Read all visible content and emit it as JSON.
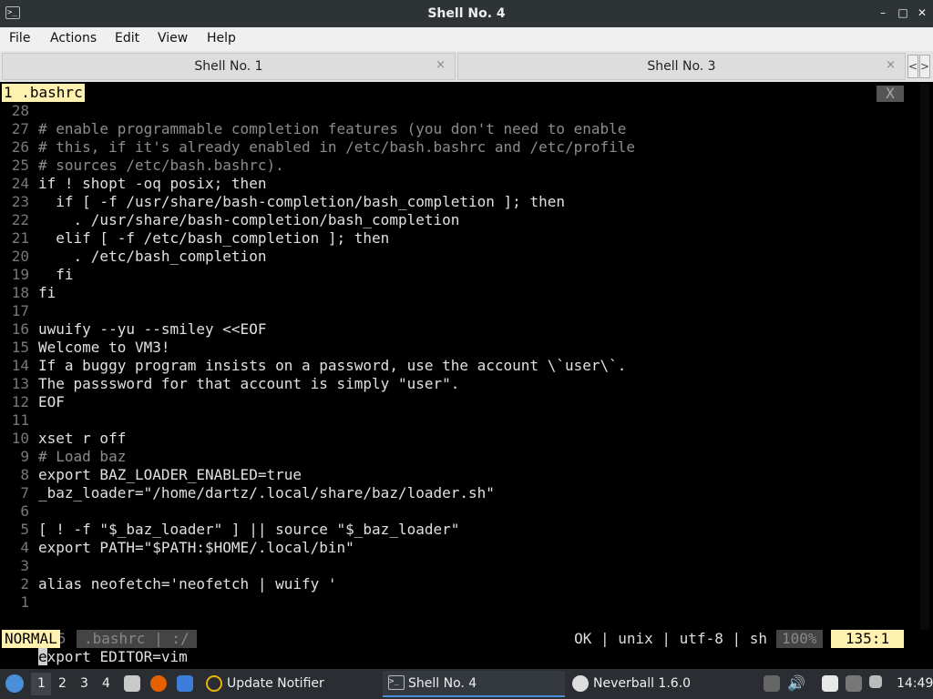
{
  "window": {
    "title": "Shell No. 4",
    "app_icon": "terminal-icon",
    "controls": [
      "minimize-icon",
      "maximize-icon",
      "close-icon"
    ]
  },
  "menu": {
    "file": "File",
    "actions": "Actions",
    "edit": "Edit",
    "view": "View",
    "help": "Help"
  },
  "tabs": [
    {
      "label": "Shell No. 1",
      "close": "×"
    },
    {
      "label": "Shell No. 3",
      "close": "×"
    }
  ],
  "tab_nav": {
    "prev": "<",
    "next": ">"
  },
  "vim": {
    "buffer": "1 .bashrc",
    "buffer_close": "X",
    "lines": [
      {
        "num": "28",
        "text": ""
      },
      {
        "num": "27",
        "text": "# enable programmable completion features (you don't need to enable"
      },
      {
        "num": "26",
        "text": "# this, if it's already enabled in /etc/bash.bashrc and /etc/profile"
      },
      {
        "num": "25",
        "text": "# sources /etc/bash.bashrc)."
      },
      {
        "num": "24",
        "text": "if ! shopt -oq posix; then"
      },
      {
        "num": "23",
        "text": "  if [ -f /usr/share/bash-completion/bash_completion ]; then"
      },
      {
        "num": "22",
        "text": "    . /usr/share/bash-completion/bash_completion"
      },
      {
        "num": "21",
        "text": "  elif [ -f /etc/bash_completion ]; then"
      },
      {
        "num": "20",
        "text": "    . /etc/bash_completion"
      },
      {
        "num": "19",
        "text": "  fi"
      },
      {
        "num": "18",
        "text": "fi"
      },
      {
        "num": "17",
        "text": ""
      },
      {
        "num": "16",
        "text": "uwuify --yu --smiley <<EOF"
      },
      {
        "num": "15",
        "text": "Welcome to VM3!"
      },
      {
        "num": "14",
        "text": "If a buggy program insists on a password, use the account \\`user\\`."
      },
      {
        "num": "13",
        "text": "The passsword for that account is simply \"user\"."
      },
      {
        "num": "12",
        "text": "EOF"
      },
      {
        "num": "11",
        "text": ""
      },
      {
        "num": "10",
        "text": "xset r off"
      },
      {
        "num": "9",
        "text": "# Load baz"
      },
      {
        "num": "8",
        "text": "export BAZ_LOADER_ENABLED=true"
      },
      {
        "num": "7",
        "text": "_baz_loader=\"/home/dartz/.local/share/baz/loader.sh\""
      },
      {
        "num": "6",
        "text": ""
      },
      {
        "num": "5",
        "text": "[ ! -f \"$_baz_loader\" ] || source \"$_baz_loader\""
      },
      {
        "num": "4",
        "text": "export PATH=\"$PATH:$HOME/.local/bin\""
      },
      {
        "num": "3",
        "text": ""
      },
      {
        "num": "2",
        "text": "alias neofetch='neofetch | wuify '"
      },
      {
        "num": "1",
        "text": ""
      }
    ],
    "current_line": {
      "num": "135",
      "cursor_char": "e",
      "rest": "xport EDITOR=vim"
    },
    "status": {
      "mode": "NORMAL",
      "file": ".bashrc | :/",
      "format": "OK | unix | utf-8 | sh",
      "percent": "100%",
      "position": "135:1"
    }
  },
  "taskbar": {
    "menu_icon": "start-menu-icon",
    "workspaces": [
      "1",
      "2",
      "3",
      "4"
    ],
    "launchers": [
      "file-manager-icon",
      "firefox-icon",
      "window-icon"
    ],
    "tasks": [
      {
        "label": "Update Notifier",
        "icon": "update-notifier-icon"
      },
      {
        "label": "Shell No. 4",
        "icon": "terminal-icon"
      },
      {
        "label": "Neverball 1.6.0",
        "icon": "neverball-icon"
      }
    ],
    "tray": [
      "display-icon",
      "volume-icon",
      "clipboard-icon",
      "network-icon",
      "notification-icon"
    ],
    "clock": "14:49"
  }
}
